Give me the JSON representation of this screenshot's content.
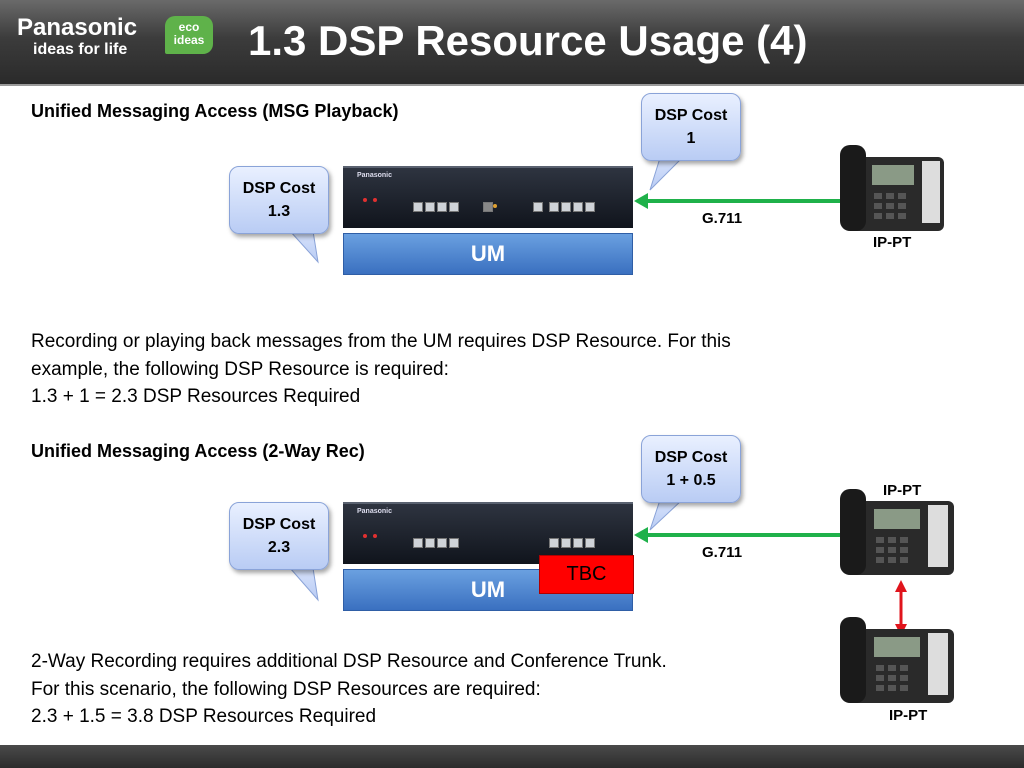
{
  "header": {
    "brand": "Panasonic",
    "tagline": "ideas for life",
    "eco_badge": [
      "eco",
      "ideas"
    ],
    "title": "1.3 DSP Resource Usage (4)"
  },
  "section1": {
    "heading": "Unified Messaging Access (MSG Playback)",
    "callout_left": [
      "DSP Cost",
      "1.3"
    ],
    "callout_right": [
      "DSP Cost",
      "1"
    ],
    "um_label": "UM",
    "codec_label": "G.711",
    "phone_label": "IP-PT",
    "description": [
      "Recording or playing back messages from the UM requires DSP Resource. For this",
      "example, the following DSP Resource is required:",
      "1.3 +  1 = 2.3 DSP Resources Required"
    ]
  },
  "section2": {
    "heading": "Unified Messaging Access (2-Way Rec)",
    "callout_left": [
      "DSP Cost",
      "2.3"
    ],
    "callout_right": [
      "DSP Cost",
      "1 + 0.5"
    ],
    "um_label": "UM",
    "tbc_label": "TBC",
    "codec_label": "G.711",
    "phone_top_label": "IP-PT",
    "phone_bottom_label": "IP-PT",
    "description": [
      "2-Way Recording requires additional DSP Resource and Conference Trunk.",
      "For this scenario, the following DSP Resources are required:",
      "2.3 +  1.5 = 3.8 DSP Resources Required"
    ]
  },
  "colors": {
    "header_bg": "#3c3c3c",
    "callout_fill": "#c9d8f8",
    "um_bar": "#4a80cc",
    "green_arrow": "#1fb14a",
    "red_arrow": "#e0141c",
    "tbc": "#ff0000",
    "eco_green": "#5fb24a"
  },
  "icons": [
    "panasonic-logo",
    "eco-ideas-badge",
    "ip-phone-icon",
    "um-device-icon"
  ]
}
